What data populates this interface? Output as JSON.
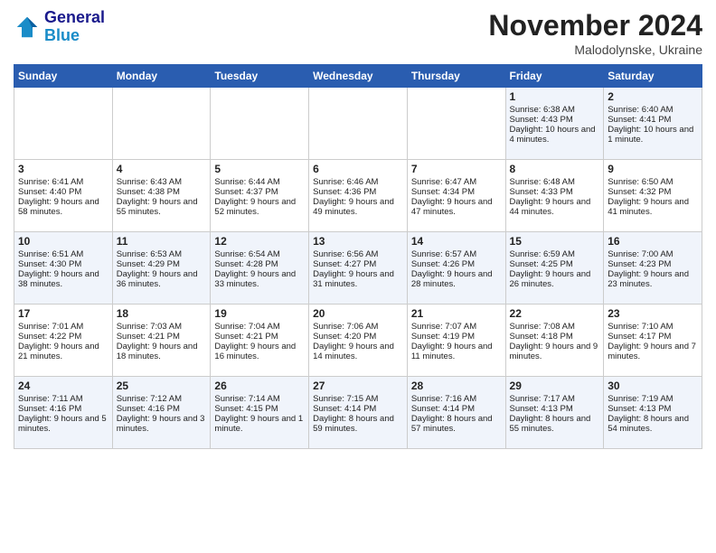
{
  "logo": {
    "line1": "General",
    "line2": "Blue"
  },
  "title": "November 2024",
  "location": "Malodolynske, Ukraine",
  "days_of_week": [
    "Sunday",
    "Monday",
    "Tuesday",
    "Wednesday",
    "Thursday",
    "Friday",
    "Saturday"
  ],
  "weeks": [
    [
      {
        "day": "",
        "sunrise": "",
        "sunset": "",
        "daylight": ""
      },
      {
        "day": "",
        "sunrise": "",
        "sunset": "",
        "daylight": ""
      },
      {
        "day": "",
        "sunrise": "",
        "sunset": "",
        "daylight": ""
      },
      {
        "day": "",
        "sunrise": "",
        "sunset": "",
        "daylight": ""
      },
      {
        "day": "",
        "sunrise": "",
        "sunset": "",
        "daylight": ""
      },
      {
        "day": "1",
        "sunrise": "Sunrise: 6:38 AM",
        "sunset": "Sunset: 4:43 PM",
        "daylight": "Daylight: 10 hours and 4 minutes."
      },
      {
        "day": "2",
        "sunrise": "Sunrise: 6:40 AM",
        "sunset": "Sunset: 4:41 PM",
        "daylight": "Daylight: 10 hours and 1 minute."
      }
    ],
    [
      {
        "day": "3",
        "sunrise": "Sunrise: 6:41 AM",
        "sunset": "Sunset: 4:40 PM",
        "daylight": "Daylight: 9 hours and 58 minutes."
      },
      {
        "day": "4",
        "sunrise": "Sunrise: 6:43 AM",
        "sunset": "Sunset: 4:38 PM",
        "daylight": "Daylight: 9 hours and 55 minutes."
      },
      {
        "day": "5",
        "sunrise": "Sunrise: 6:44 AM",
        "sunset": "Sunset: 4:37 PM",
        "daylight": "Daylight: 9 hours and 52 minutes."
      },
      {
        "day": "6",
        "sunrise": "Sunrise: 6:46 AM",
        "sunset": "Sunset: 4:36 PM",
        "daylight": "Daylight: 9 hours and 49 minutes."
      },
      {
        "day": "7",
        "sunrise": "Sunrise: 6:47 AM",
        "sunset": "Sunset: 4:34 PM",
        "daylight": "Daylight: 9 hours and 47 minutes."
      },
      {
        "day": "8",
        "sunrise": "Sunrise: 6:48 AM",
        "sunset": "Sunset: 4:33 PM",
        "daylight": "Daylight: 9 hours and 44 minutes."
      },
      {
        "day": "9",
        "sunrise": "Sunrise: 6:50 AM",
        "sunset": "Sunset: 4:32 PM",
        "daylight": "Daylight: 9 hours and 41 minutes."
      }
    ],
    [
      {
        "day": "10",
        "sunrise": "Sunrise: 6:51 AM",
        "sunset": "Sunset: 4:30 PM",
        "daylight": "Daylight: 9 hours and 38 minutes."
      },
      {
        "day": "11",
        "sunrise": "Sunrise: 6:53 AM",
        "sunset": "Sunset: 4:29 PM",
        "daylight": "Daylight: 9 hours and 36 minutes."
      },
      {
        "day": "12",
        "sunrise": "Sunrise: 6:54 AM",
        "sunset": "Sunset: 4:28 PM",
        "daylight": "Daylight: 9 hours and 33 minutes."
      },
      {
        "day": "13",
        "sunrise": "Sunrise: 6:56 AM",
        "sunset": "Sunset: 4:27 PM",
        "daylight": "Daylight: 9 hours and 31 minutes."
      },
      {
        "day": "14",
        "sunrise": "Sunrise: 6:57 AM",
        "sunset": "Sunset: 4:26 PM",
        "daylight": "Daylight: 9 hours and 28 minutes."
      },
      {
        "day": "15",
        "sunrise": "Sunrise: 6:59 AM",
        "sunset": "Sunset: 4:25 PM",
        "daylight": "Daylight: 9 hours and 26 minutes."
      },
      {
        "day": "16",
        "sunrise": "Sunrise: 7:00 AM",
        "sunset": "Sunset: 4:23 PM",
        "daylight": "Daylight: 9 hours and 23 minutes."
      }
    ],
    [
      {
        "day": "17",
        "sunrise": "Sunrise: 7:01 AM",
        "sunset": "Sunset: 4:22 PM",
        "daylight": "Daylight: 9 hours and 21 minutes."
      },
      {
        "day": "18",
        "sunrise": "Sunrise: 7:03 AM",
        "sunset": "Sunset: 4:21 PM",
        "daylight": "Daylight: 9 hours and 18 minutes."
      },
      {
        "day": "19",
        "sunrise": "Sunrise: 7:04 AM",
        "sunset": "Sunset: 4:21 PM",
        "daylight": "Daylight: 9 hours and 16 minutes."
      },
      {
        "day": "20",
        "sunrise": "Sunrise: 7:06 AM",
        "sunset": "Sunset: 4:20 PM",
        "daylight": "Daylight: 9 hours and 14 minutes."
      },
      {
        "day": "21",
        "sunrise": "Sunrise: 7:07 AM",
        "sunset": "Sunset: 4:19 PM",
        "daylight": "Daylight: 9 hours and 11 minutes."
      },
      {
        "day": "22",
        "sunrise": "Sunrise: 7:08 AM",
        "sunset": "Sunset: 4:18 PM",
        "daylight": "Daylight: 9 hours and 9 minutes."
      },
      {
        "day": "23",
        "sunrise": "Sunrise: 7:10 AM",
        "sunset": "Sunset: 4:17 PM",
        "daylight": "Daylight: 9 hours and 7 minutes."
      }
    ],
    [
      {
        "day": "24",
        "sunrise": "Sunrise: 7:11 AM",
        "sunset": "Sunset: 4:16 PM",
        "daylight": "Daylight: 9 hours and 5 minutes."
      },
      {
        "day": "25",
        "sunrise": "Sunrise: 7:12 AM",
        "sunset": "Sunset: 4:16 PM",
        "daylight": "Daylight: 9 hours and 3 minutes."
      },
      {
        "day": "26",
        "sunrise": "Sunrise: 7:14 AM",
        "sunset": "Sunset: 4:15 PM",
        "daylight": "Daylight: 9 hours and 1 minute."
      },
      {
        "day": "27",
        "sunrise": "Sunrise: 7:15 AM",
        "sunset": "Sunset: 4:14 PM",
        "daylight": "Daylight: 8 hours and 59 minutes."
      },
      {
        "day": "28",
        "sunrise": "Sunrise: 7:16 AM",
        "sunset": "Sunset: 4:14 PM",
        "daylight": "Daylight: 8 hours and 57 minutes."
      },
      {
        "day": "29",
        "sunrise": "Sunrise: 7:17 AM",
        "sunset": "Sunset: 4:13 PM",
        "daylight": "Daylight: 8 hours and 55 minutes."
      },
      {
        "day": "30",
        "sunrise": "Sunrise: 7:19 AM",
        "sunset": "Sunset: 4:13 PM",
        "daylight": "Daylight: 8 hours and 54 minutes."
      }
    ]
  ]
}
